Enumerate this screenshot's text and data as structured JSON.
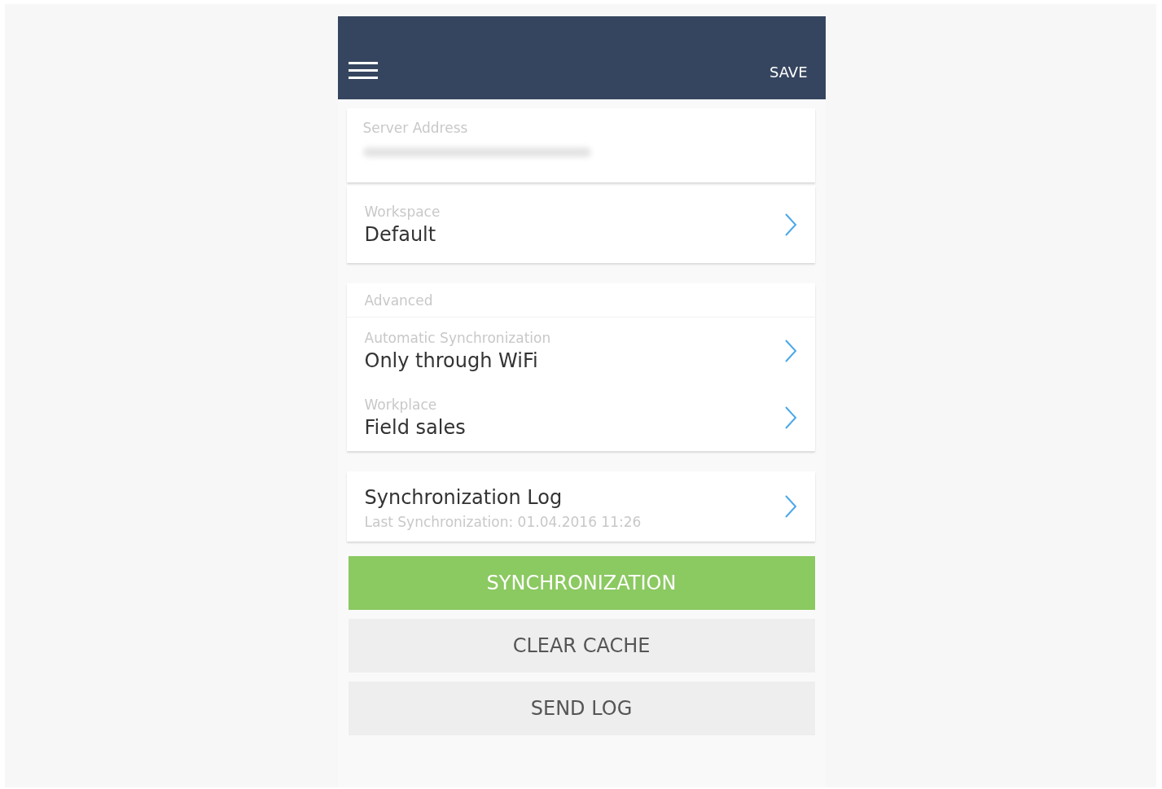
{
  "header": {
    "action": "SAVE"
  },
  "server": {
    "label": "Server Address"
  },
  "workspace": {
    "label": "Workspace",
    "value": "Default"
  },
  "advanced": {
    "title": "Advanced",
    "items": [
      {
        "label": "Automatic Synchronization",
        "value": "Only through WiFi"
      },
      {
        "label": "Workplace",
        "value": "Field sales"
      }
    ]
  },
  "log": {
    "title": "Synchronization Log",
    "subtitle": "Last Synchronization: 01.04.2016 11:26"
  },
  "buttons": [
    {
      "label": "SYNCHRONIZATION",
      "kind": "primary"
    },
    {
      "label": "CLEAR CACHE",
      "kind": "secondary"
    },
    {
      "label": "SEND LOG",
      "kind": "secondary"
    }
  ]
}
